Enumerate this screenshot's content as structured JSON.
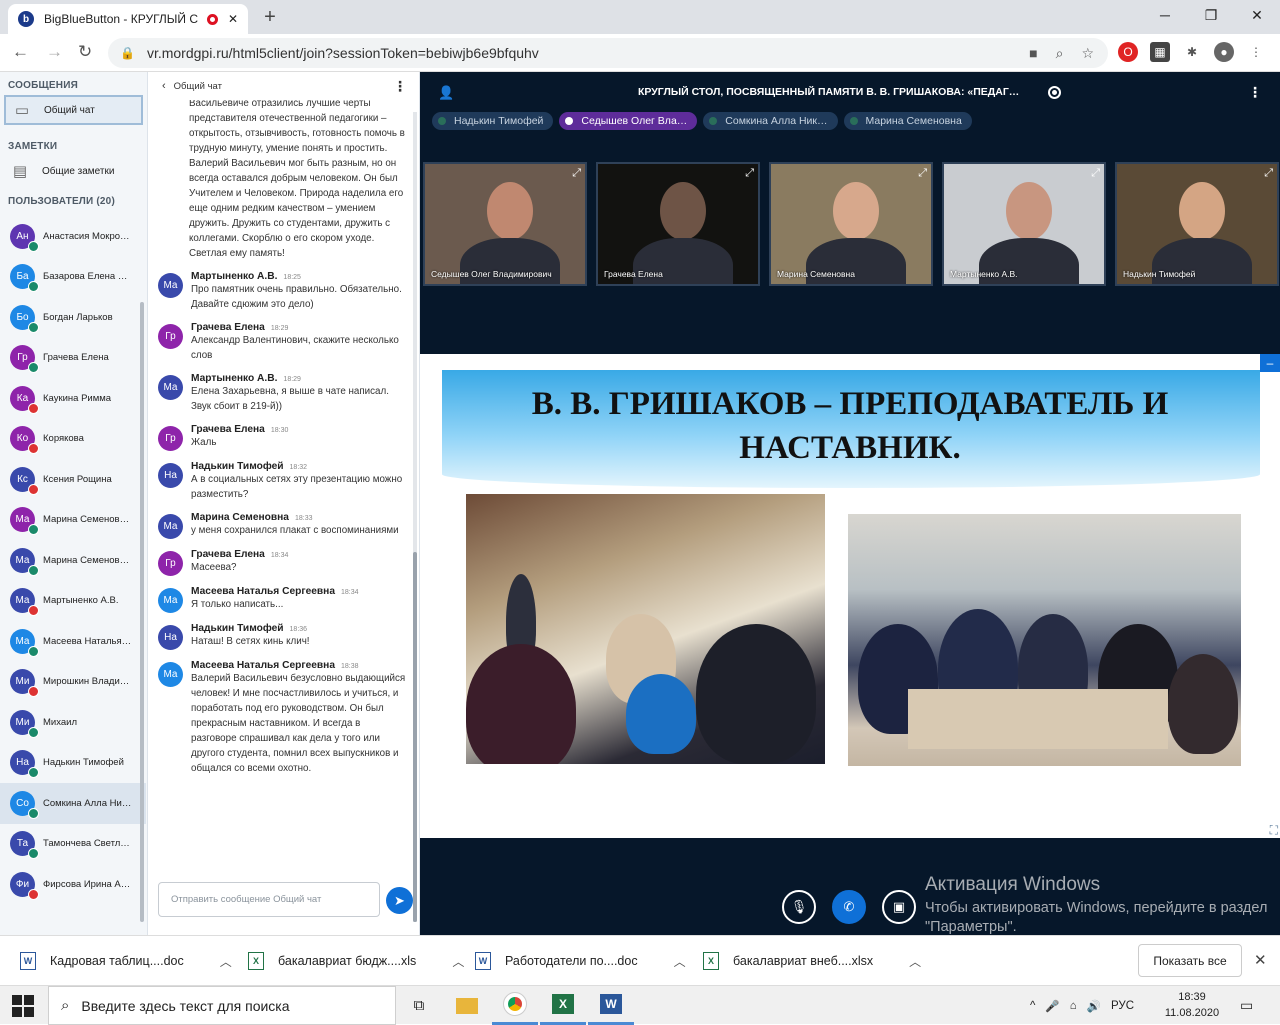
{
  "browser": {
    "tab_title": "BigBlueButton - КРУГЛЫЙ С",
    "favicon_letter": "b",
    "new_tab": "+",
    "url": "vr.mordgpi.ru/html5client/join?sessionToken=bebiwjb6e9bfquhv"
  },
  "sidebar": {
    "messages_header": "СООБЩЕНИЯ",
    "public_chat": "Общий чат",
    "notes_header": "ЗАМЕТКИ",
    "shared_notes": "Общие заметки",
    "users_header": "ПОЛЬЗОВАТЕЛИ (20)",
    "users": [
      {
        "initials": "Ан",
        "name": "Анастасия Мокро…",
        "color": "#5e35b1",
        "status": "mic"
      },
      {
        "initials": "Ба",
        "name": "Базарова Елена …",
        "color": "#1e88e5",
        "status": "mic"
      },
      {
        "initials": "Бо",
        "name": "Богдан Ларьков",
        "color": "#1e88e5",
        "status": "mic"
      },
      {
        "initials": "Гр",
        "name": "Грачева Елена",
        "color": "#8e24aa",
        "status": "mic"
      },
      {
        "initials": "Ка",
        "name": "Каукина Римма",
        "color": "#8e24aa",
        "status": "muted"
      },
      {
        "initials": "Ко",
        "name": "Корякова",
        "color": "#8e24aa",
        "status": "muted"
      },
      {
        "initials": "Кс",
        "name": "Ксения Рощина",
        "color": "#3949ab",
        "status": "muted"
      },
      {
        "initials": "Ма",
        "name": "Марина Семенов…",
        "color": "#8e24aa",
        "status": "mic"
      },
      {
        "initials": "Ма",
        "name": "Марина Семенов…",
        "color": "#3949ab",
        "status": "mic"
      },
      {
        "initials": "Ма",
        "name": "Мартыненко А.В.",
        "color": "#3949ab",
        "status": "muted"
      },
      {
        "initials": "Ма",
        "name": "Масеева Наталья…",
        "color": "#1e88e5",
        "status": "mic"
      },
      {
        "initials": "Ми",
        "name": "Мирошкин Влади…",
        "color": "#3949ab",
        "status": "muted"
      },
      {
        "initials": "Ми",
        "name": "Михаил",
        "color": "#3949ab",
        "status": "mic"
      },
      {
        "initials": "На",
        "name": "Надькин Тимофей",
        "color": "#3949ab",
        "status": "mic"
      },
      {
        "initials": "Со",
        "name": "Сомкина Алла Ни…",
        "color": "#1e88e5",
        "status": "mic"
      },
      {
        "initials": "Та",
        "name": "Тамончева Светл…",
        "color": "#3949ab",
        "status": "mic"
      },
      {
        "initials": "Фи",
        "name": "Фирсова Ирина А…",
        "color": "#3949ab",
        "status": "muted"
      }
    ]
  },
  "chat": {
    "header": "Общий чат",
    "first_text": "Васильевиче отразились лучшие черты представителя отечественной педагогики – открытость, отзывчивость, готовность помочь в трудную минуту, умение понять и простить. Валерий Васильевич мог быть разным, но он всегда оставался добрым человеком. Он был Учителем и Человеком. Природа наделила его еще одним редким качеством – умением дружить. Дружить со студентами, дружить с коллегами. Скорблю о его скором уходе. Светлая ему память!",
    "messages": [
      {
        "initials": "Ма",
        "color": "#3949ab",
        "author": "Мартыненко А.В.",
        "time": "18:25",
        "text": "Про памятник очень правильно. Обязательно. Давайте сдюжим это дело)"
      },
      {
        "initials": "Гр",
        "color": "#8e24aa",
        "author": "Грачева Елена",
        "time": "18:29",
        "text": "Александр Валентинович, скажите несколько слов"
      },
      {
        "initials": "Ма",
        "color": "#3949ab",
        "author": "Мартыненко А.В.",
        "time": "18:29",
        "text": "Елена Захарьевна, я выше в чате написал. Звук сбоит в 219-й))"
      },
      {
        "initials": "Гр",
        "color": "#8e24aa",
        "author": "Грачева Елена",
        "time": "18:30",
        "text": "Жаль"
      },
      {
        "initials": "На",
        "color": "#3949ab",
        "author": "Надькин Тимофей",
        "time": "18:32",
        "text": "А в социальных сетях эту презентацию можно разместить?"
      },
      {
        "initials": "Ма",
        "color": "#3949ab",
        "author": "Марина Семеновна",
        "time": "18:33",
        "text": "у меня сохранился плакат с воспоминаниями"
      },
      {
        "initials": "Гр",
        "color": "#8e24aa",
        "author": "Грачева Елена",
        "time": "18:34",
        "text": "Масеева?"
      },
      {
        "initials": "Ма",
        "color": "#1e88e5",
        "author": "Масеева Наталья Сергеевна",
        "time": "18:34",
        "text": "Я только написать..."
      },
      {
        "initials": "На",
        "color": "#3949ab",
        "author": "Надькин Тимофей",
        "time": "18:36",
        "text": "Наташ! В сетях кинь клич!"
      },
      {
        "initials": "Ма",
        "color": "#1e88e5",
        "author": "Масеева Наталья Сергеевна",
        "time": "18:38",
        "text": "Валерий Васильевич безусловно выдающийся человек! И мне посчастливилось и учиться, и поработать под его руководством. Он был прекрасным наставником. И всегда в разговоре спрашивал как дела у того или другого студента, помнил всех выпускников и общался со всеми охотно."
      }
    ],
    "input_placeholder": "Отправить сообщение Общий чат"
  },
  "meeting": {
    "title": "КРУГЛЫЙ СТОЛ, ПОСВЯЩЕННЫЙ ПАМЯТИ В. В. ГРИШАКОВА: «ПЕДАГ…",
    "talkers": [
      {
        "name": "Надькин Тимофей",
        "active": false
      },
      {
        "name": "Седышев Олег Вла…",
        "active": true
      },
      {
        "name": "Сомкина Алла Ник…",
        "active": false
      },
      {
        "name": "Марина Семеновна",
        "active": false
      }
    ],
    "videos": [
      {
        "name": "Седышев Олег Владимирович",
        "bg": "#6b5a4e",
        "face": "#c08870"
      },
      {
        "name": "Грачева Елена",
        "bg": "#121210",
        "face": "#6e5446"
      },
      {
        "name": "Марина Семеновна",
        "bg": "#8a7b60",
        "face": "#d7a88c"
      },
      {
        "name": "Мартыненко А.В.",
        "bg": "#c9ccd0",
        "face": "#c89680"
      },
      {
        "name": "Надькин Тимофей",
        "bg": "#5a4a36",
        "face": "#d4a584"
      }
    ],
    "slide_title": "В. В. ГРИШАКОВ – ПРЕПОДАВАТЕЛЬ И НАСТАВНИК."
  },
  "watermark": {
    "line1": "Активация Windows",
    "line2": "Чтобы активировать Windows, перейдите в раздел \"Параметры\"."
  },
  "downloads": {
    "items": [
      {
        "name": "Кадровая таблиц....doc",
        "type": "W",
        "color": "#2b579a"
      },
      {
        "name": "бакалавриат бюдж....xls",
        "type": "X",
        "color": "#217346"
      },
      {
        "name": "Работодатели по....doc",
        "type": "W",
        "color": "#2b579a"
      },
      {
        "name": "бакалавриат внеб....xlsx",
        "type": "X",
        "color": "#217346"
      }
    ],
    "show_all": "Показать все"
  },
  "taskbar": {
    "search_placeholder": "Введите здесь текст для поиска",
    "lang": "РУС",
    "time": "18:39",
    "date": "11.08.2020"
  }
}
